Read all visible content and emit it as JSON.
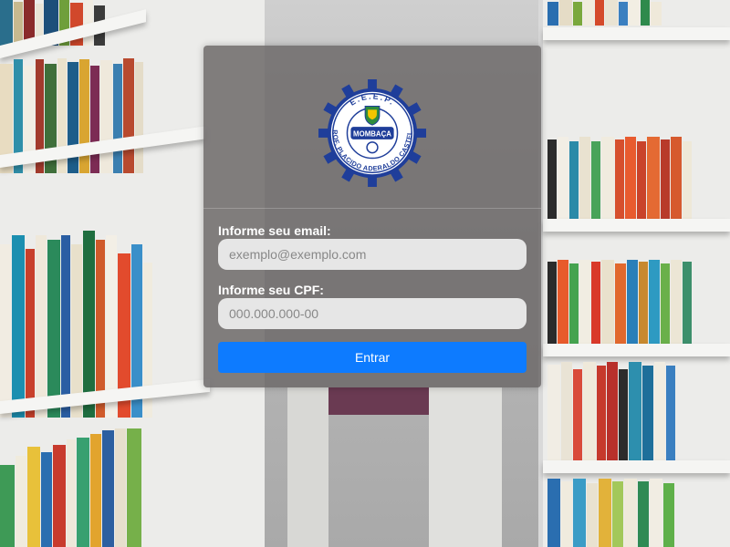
{
  "logo": {
    "name": "E.E.E.P. PROF. PLACIDO ADERALDO CASTELO",
    "top_text": "E.E.E.P.",
    "ring_text": "PROF. PLACIDO ADERALDO CASTELO",
    "banner": "MOMBAÇA",
    "colors": {
      "blue": "#1f3e9a",
      "white": "#ffffff",
      "green": "#2e8b3d",
      "yellow": "#f2c500"
    }
  },
  "form": {
    "email_label": "Informe seu email:",
    "email_placeholder": "exemplo@exemplo.com",
    "email_value": "",
    "cpf_label": "Informe seu CPF:",
    "cpf_placeholder": "000.000.000-00",
    "cpf_value": "",
    "submit_label": "Entrar"
  },
  "colors": {
    "button": "#0d7bff",
    "card": "#6e6a6a"
  }
}
